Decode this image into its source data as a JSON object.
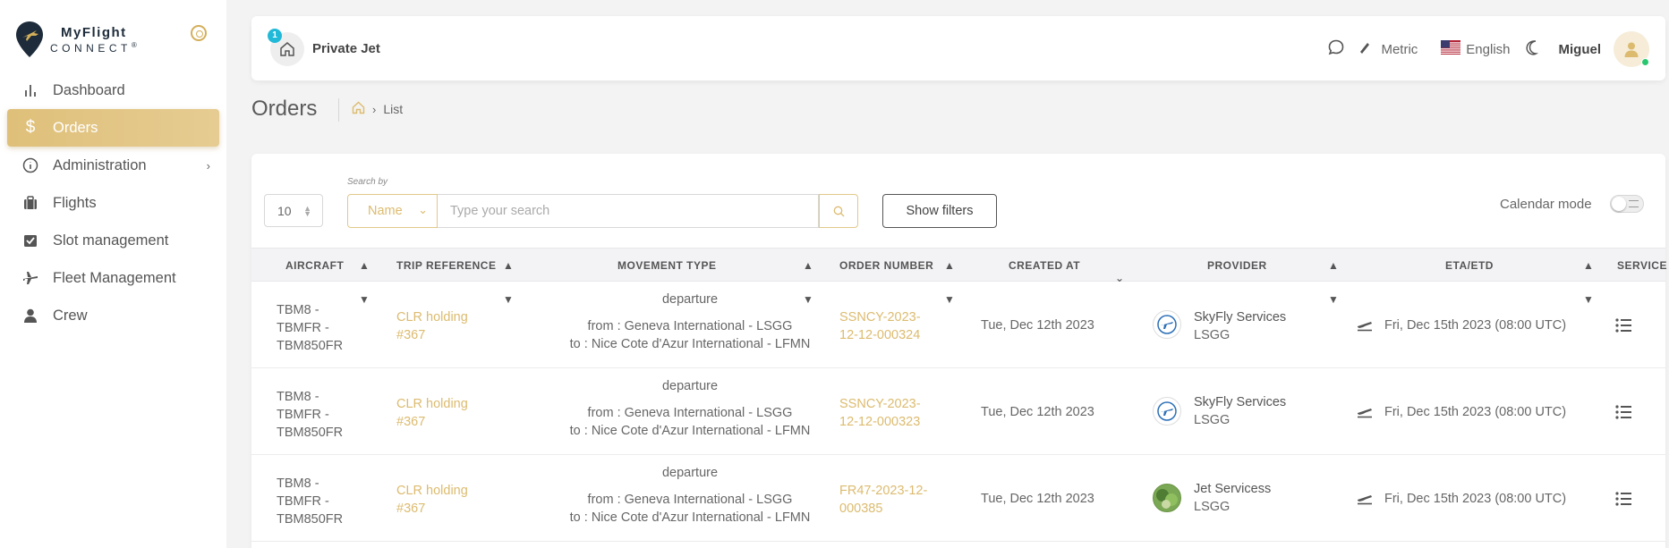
{
  "brand": {
    "title": "MyFlight",
    "subtitle": "CONNECT",
    "mark": "®"
  },
  "sidebar": {
    "items": [
      {
        "label": "Dashboard",
        "icon": "bar-chart-icon",
        "active": false
      },
      {
        "label": "Orders",
        "icon": "dollar-icon",
        "active": true
      },
      {
        "label": "Administration",
        "icon": "info-icon",
        "active": false,
        "has_children": true
      },
      {
        "label": "Flights",
        "icon": "suitcase-icon",
        "active": false
      },
      {
        "label": "Slot management",
        "icon": "calendar-check-icon",
        "active": false
      },
      {
        "label": "Fleet Management",
        "icon": "plane-icon",
        "active": false
      },
      {
        "label": "Crew",
        "icon": "person-icon",
        "active": false
      }
    ]
  },
  "topbar": {
    "notification_count": "1",
    "org_name": "Private Jet",
    "units": "Metric",
    "language": "English",
    "user_name": "Miguel"
  },
  "page": {
    "title": "Orders",
    "breadcrumb": "List"
  },
  "toolbar": {
    "page_size": "10",
    "search_label": "Search by",
    "search_field": "Name",
    "search_placeholder": "Type your search",
    "filters_label": "Show filters",
    "calendar_label": "Calendar mode"
  },
  "table": {
    "headers": {
      "aircraft": "AIRCRAFT",
      "trip_reference": "TRIP REFERENCE",
      "movement_type": "MOVEMENT TYPE",
      "order_number": "ORDER NUMBER",
      "created_at": "CREATED AT",
      "provider": "PROVIDER",
      "eta_etd": "ETA/ETD",
      "services": "SERVICE"
    },
    "rows": [
      {
        "aircraft": [
          "TBM8 -",
          "TBMFR -",
          "TBM850FR"
        ],
        "trip_reference": [
          "CLR holding",
          "#367"
        ],
        "movement": "departure",
        "from": "from : Geneva International - LSGG",
        "to": "to : Nice Cote d'Azur International - LFMN",
        "order_number": [
          "SSNCY-2023-",
          "12-12-000324"
        ],
        "created_at": "Tue, Dec 12th 2023",
        "provider_name": "SkyFly Services",
        "provider_code": "LSGG",
        "eta": "Fri, Dec 15th 2023 (08:00 UTC)"
      },
      {
        "aircraft": [
          "TBM8 -",
          "TBMFR -",
          "TBM850FR"
        ],
        "trip_reference": [
          "CLR holding",
          "#367"
        ],
        "movement": "departure",
        "from": "from : Geneva International - LSGG",
        "to": "to : Nice Cote d'Azur International - LFMN",
        "order_number": [
          "SSNCY-2023-",
          "12-12-000323"
        ],
        "created_at": "Tue, Dec 12th 2023",
        "provider_name": "SkyFly Services",
        "provider_code": "LSGG",
        "eta": "Fri, Dec 15th 2023 (08:00 UTC)"
      },
      {
        "aircraft": [
          "TBM8 -",
          "TBMFR -",
          "TBM850FR"
        ],
        "trip_reference": [
          "CLR holding",
          "#367"
        ],
        "movement": "departure",
        "from": "from : Geneva International - LSGG",
        "to": "to : Nice Cote d'Azur International - LFMN",
        "order_number": [
          "FR47-2023-12-",
          "000385"
        ],
        "created_at": "Tue, Dec 12th 2023",
        "provider_name": "Jet Servicess",
        "provider_code": "LSGG",
        "eta": "Fri, Dec 15th 2023 (08:00 UTC)"
      }
    ]
  },
  "colors": {
    "accent": "#dcbb6f",
    "badge": "#21b9d8",
    "online": "#28c76f"
  }
}
